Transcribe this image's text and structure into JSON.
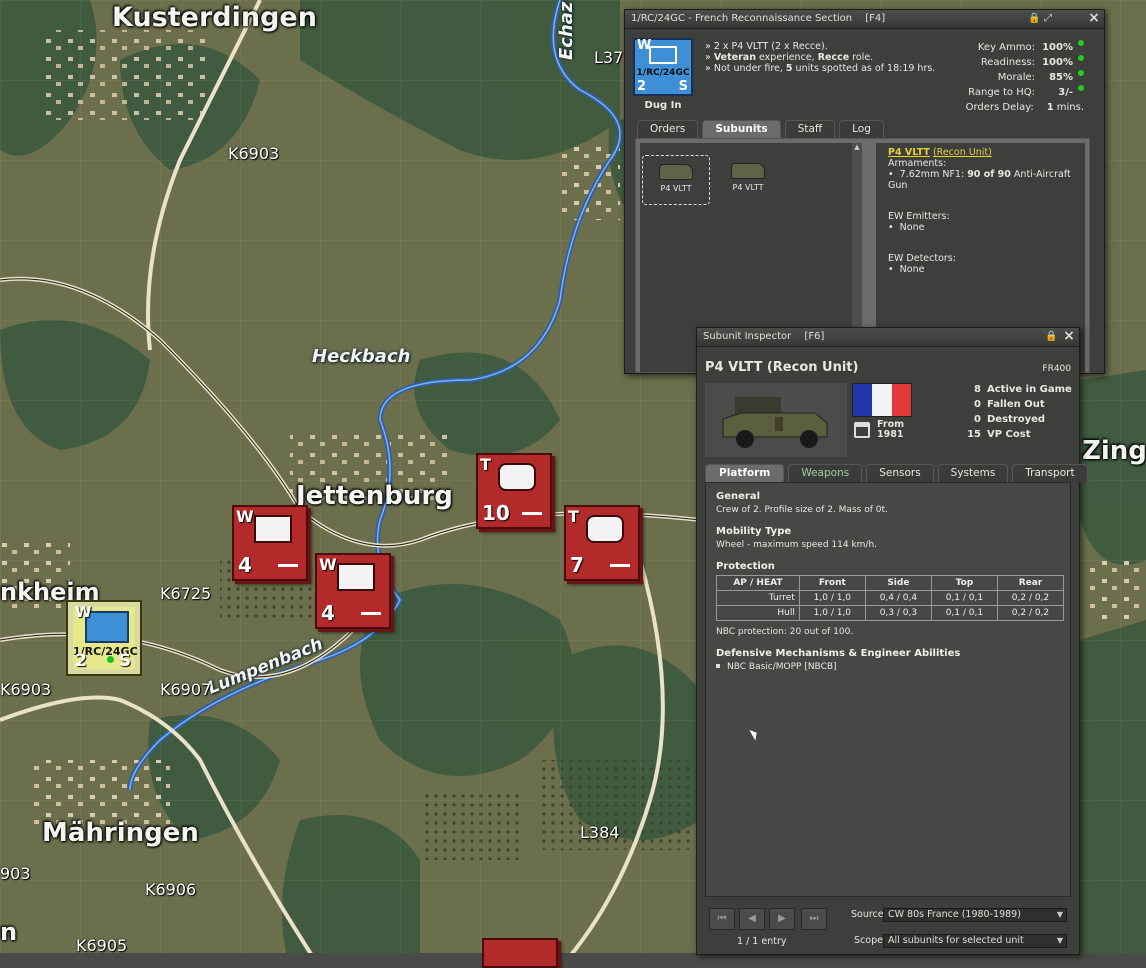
{
  "map": {
    "towns": [
      "Kusterdingen",
      "Jettenburg",
      "Mähringen",
      "nkheim",
      "Zingen"
    ],
    "streams": [
      "Heckbach",
      "Lumpenbach",
      "Echaz"
    ],
    "roads": [
      "K6903",
      "K6725",
      "K6907",
      "K6903",
      "K6906",
      "K6905",
      "L384",
      "L37",
      "903",
      "n"
    ],
    "enemy_units": [
      {
        "letter": "W",
        "strength": "4"
      },
      {
        "letter": "W",
        "strength": "4"
      },
      {
        "letter": "T",
        "strength": "10"
      },
      {
        "letter": "T",
        "strength": "7"
      }
    ],
    "friendly_unit": {
      "letter": "W",
      "id": "1/RC/24GC",
      "number": "2",
      "size": "S"
    }
  },
  "unit_panel": {
    "title": "1/RC/24GC - French Reconnaissance Section",
    "hotkey": "[F4]",
    "status": "Dug In",
    "lines": [
      [
        "» 2 x P4 VLTT (2 x Recce)."
      ],
      [
        "» ",
        "Veteran",
        " experience, ",
        "Recce",
        " role."
      ],
      [
        "» Not under fire, ",
        "5",
        " units spotted as of 18:19 hrs."
      ]
    ],
    "stats": [
      {
        "label": "Key Ammo:",
        "value": "100%"
      },
      {
        "label": "Readiness:",
        "value": "100%"
      },
      {
        "label": "Morale:",
        "value": "85%"
      },
      {
        "label": "Range to HQ:",
        "value": "3/-"
      },
      {
        "label": "Orders Delay:",
        "value": "1",
        "suffix": "mins."
      }
    ],
    "tabs": [
      "Orders",
      "Subunits",
      "Staff",
      "Log"
    ],
    "subunits": [
      "P4 VLTT",
      "P4 VLTT"
    ],
    "detail": {
      "name": "P4 VLTT",
      "role": "(Recon Unit)",
      "armaments_label": "Armaments:",
      "weapon_prefix": "7.62mm NF1: ",
      "weapon_count": "90 of 90",
      "weapon_suffix": " Anti-Aircraft Gun",
      "ew_emitters_label": "EW Emitters:",
      "ew_emitters": "None",
      "ew_detectors_label": "EW Detectors:",
      "ew_detectors": "None"
    },
    "colors": {
      "panel": "#3c3f3c",
      "unit_blue": "#3f8fd6",
      "status_green": "#22cc22"
    }
  },
  "inspector": {
    "title": "Subunit Inspector",
    "hotkey": "[F6]",
    "name": "P4 VLTT (Recon Unit)",
    "code": "FR400",
    "from_label": "From",
    "from_year": "1981",
    "stats": [
      {
        "value": "8",
        "label": "Active in Game"
      },
      {
        "value": "0",
        "label": "Fallen Out"
      },
      {
        "value": "0",
        "label": "Destroyed"
      },
      {
        "value": "15",
        "label": "VP Cost"
      }
    ],
    "tabs": [
      "Platform",
      "Weapons",
      "Sensors",
      "Systems",
      "Transport"
    ],
    "general_h": "General",
    "general_text": "Crew of 2. Profile size of 2. Mass of 0t.",
    "mobility_h": "Mobility Type",
    "mobility_text": "Wheel - maximum speed 114 km/h.",
    "protection_h": "Protection",
    "protection_cols": [
      "AP / HEAT",
      "Front",
      "Side",
      "Top",
      "Rear"
    ],
    "protection_rows": [
      [
        "Turret",
        "1,0 / 1,0",
        "0,4 / 0,4",
        "0,1 / 0,1",
        "0,2 / 0,2"
      ],
      [
        "Hull",
        "1,0 / 1,0",
        "0,3 / 0,3",
        "0,1 / 0,1",
        "0,2 / 0,2"
      ]
    ],
    "nbc_text": "NBC protection: 20 out of 100.",
    "defensive_h": "Defensive Mechanisms & Engineer Abilities",
    "defensive_items": [
      "NBC Basic/MOPP [NBCB]"
    ],
    "entry_count": "1 / 1 entry",
    "source_label": "Source",
    "source_value": "CW 80s France (1980-1989)",
    "scope_label": "Scope:",
    "scope_value": "All subunits for selected unit"
  }
}
